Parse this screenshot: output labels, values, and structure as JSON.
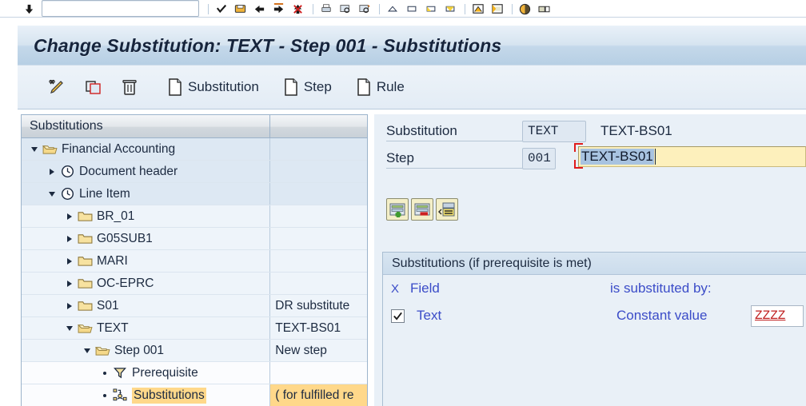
{
  "window": {
    "title": "Change Substitution: TEXT - Step 001 - Substitutions"
  },
  "system_toolbar": {
    "command_field_value": "",
    "command_field_placeholder": "",
    "icons": [
      "back-arrow-icon",
      "green-check-icon",
      "save-icon",
      "back-icon",
      "exit-icon",
      "cancel-icon",
      "print-icon",
      "find-icon",
      "find-next-icon",
      "first-page-icon",
      "previous-page-icon",
      "next-page-icon",
      "last-page-icon",
      "new-session-icon",
      "create-shortcut-icon",
      "help-icon",
      "layout-menu-icon"
    ]
  },
  "app_toolbar": {
    "buttons": [
      {
        "name": "check-button",
        "icon": "pencil-check-icon",
        "label": ""
      },
      {
        "name": "copy-button",
        "icon": "copy-icon",
        "label": ""
      },
      {
        "name": "delete-button",
        "icon": "trash-icon",
        "label": ""
      },
      {
        "name": "substitution-button",
        "icon": "document-icon",
        "label": "Substitution"
      },
      {
        "name": "step-button",
        "icon": "document-icon",
        "label": "Step"
      },
      {
        "name": "rule-button",
        "icon": "document-icon",
        "label": "Rule"
      }
    ]
  },
  "tree": {
    "columns": [
      "Substitutions",
      ""
    ],
    "rows": [
      {
        "label": "Financial Accounting",
        "desc": "",
        "indent": 0,
        "expander": "down",
        "icon": "folder-open-icon",
        "bg": "bg-blue",
        "selected": false
      },
      {
        "label": "Document header",
        "desc": "",
        "indent": 1,
        "expander": "right",
        "icon": "clock-icon",
        "bg": "bg-blue",
        "selected": false
      },
      {
        "label": "Line Item",
        "desc": "",
        "indent": 1,
        "expander": "down",
        "icon": "clock-icon",
        "bg": "bg-blue",
        "selected": false
      },
      {
        "label": "BR_01",
        "desc": "",
        "indent": 2,
        "expander": "right",
        "icon": "folder-icon",
        "bg": "bg-light",
        "selected": false
      },
      {
        "label": "G05SUB1",
        "desc": "",
        "indent": 2,
        "expander": "right",
        "icon": "folder-icon",
        "bg": "bg-light",
        "selected": false
      },
      {
        "label": "MARI",
        "desc": "",
        "indent": 2,
        "expander": "right",
        "icon": "folder-icon",
        "bg": "bg-light",
        "selected": false
      },
      {
        "label": "OC-EPRC",
        "desc": "",
        "indent": 2,
        "expander": "right",
        "icon": "folder-icon",
        "bg": "bg-light",
        "selected": false
      },
      {
        "label": "S01",
        "desc": "DR substitute",
        "indent": 2,
        "expander": "right",
        "icon": "folder-icon",
        "bg": "bg-light",
        "selected": false
      },
      {
        "label": "TEXT",
        "desc": "TEXT-BS01",
        "indent": 2,
        "expander": "down",
        "icon": "folder-open-icon",
        "bg": "bg-light",
        "selected": false
      },
      {
        "label": "Step 001",
        "desc": "New step",
        "indent": 3,
        "expander": "down",
        "icon": "folder-open-icon",
        "bg": "bg-light",
        "selected": false
      },
      {
        "label": "Prerequisite",
        "desc": "",
        "indent": 4,
        "expander": "dot",
        "icon": "funnel-icon",
        "bg": "bg-white",
        "selected": false
      },
      {
        "label": "Substitutions",
        "desc": "( for fulfilled re",
        "indent": 4,
        "expander": "dot",
        "icon": "substitution-node-icon",
        "bg": "bg-white",
        "selected": true
      }
    ]
  },
  "form": {
    "substitution_label": "Substitution",
    "substitution_value": "TEXT",
    "substitution_desc": "TEXT-BS01",
    "step_label": "Step",
    "step_value": "001",
    "step_desc_value": "TEXT-BS01"
  },
  "row_buttons": [
    {
      "name": "insert-row-button",
      "icon": "insert-row-icon"
    },
    {
      "name": "delete-row-button",
      "icon": "delete-row-icon"
    },
    {
      "name": "change-row-button",
      "icon": "change-row-icon"
    }
  ],
  "substitutions_box": {
    "title": "Substitutions (if prerequisite is met)",
    "headers": {
      "x": "X",
      "field": "Field",
      "substituted_by": "is substituted by:",
      "value": ""
    },
    "rows": [
      {
        "checked": true,
        "field": "Text",
        "substituted_by": "Constant value",
        "value": "ZZZZ"
      }
    ]
  },
  "colors": {
    "title_text": "#16243c",
    "accent_blue_label": "#3b4cc8",
    "tree_selection": "#ffd88a",
    "active_field_bg": "#fdf0bc",
    "focus_bracket": "#e01b1b",
    "value_red": "#c02020",
    "panel_bg": "#e9f0f7",
    "tree_row_blue": "#dde8f3"
  }
}
